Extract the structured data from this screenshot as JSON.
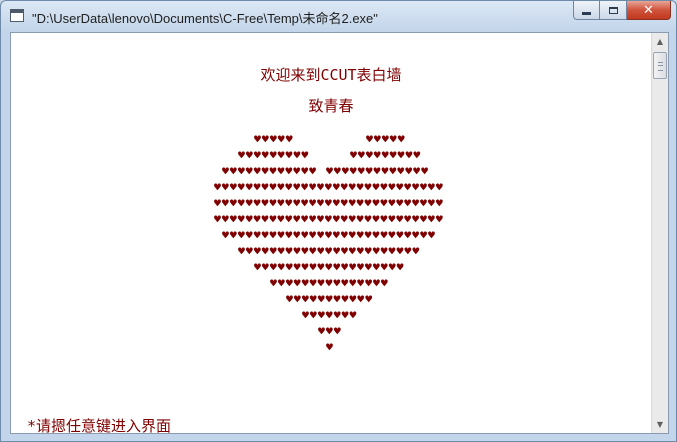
{
  "window": {
    "title": "\"D:\\UserData\\lenovo\\Documents\\C-Free\\Temp\\未命名2.exe\"",
    "icons": {
      "app": "console-window-icon",
      "minimize": "minimize-icon",
      "maximize": "maximize-icon",
      "close": "close-icon"
    },
    "close_glyph": "✕"
  },
  "console": {
    "welcome_line": "欢迎来到CCUT表白墙",
    "subtitle_line": "致青春",
    "heart_glyph": "♥",
    "heart_color": "#800000",
    "prompt_line": "*请摁任意键进入界面"
  },
  "scrollbar": {
    "up_glyph": "▲",
    "down_glyph": "▼"
  }
}
